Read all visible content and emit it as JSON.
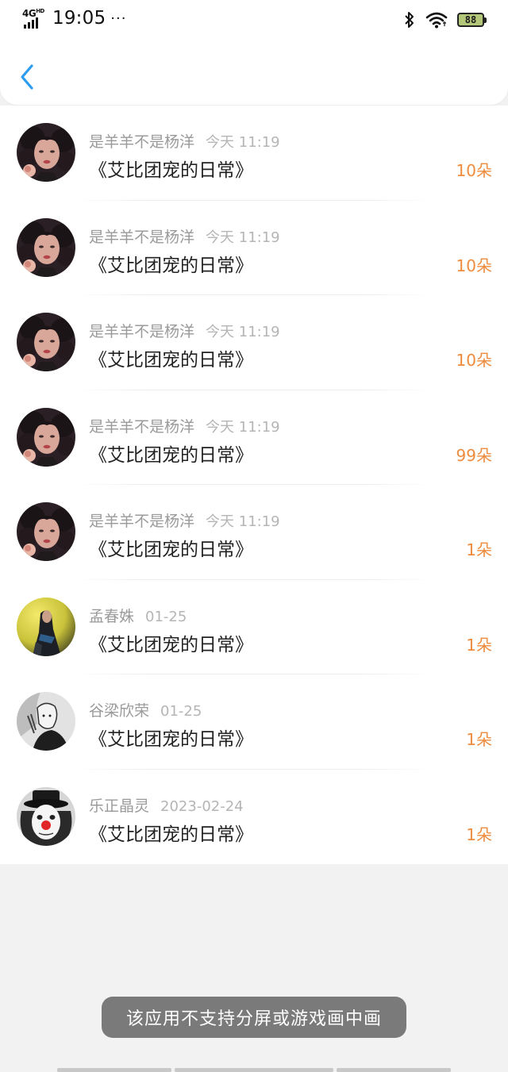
{
  "status_bar": {
    "network": "4G",
    "network_sup": "HD",
    "time": "19:05",
    "more": "···",
    "battery": "88"
  },
  "header": {
    "back_icon": "chevron-left-icon",
    "accent_color": "#2c9cf0"
  },
  "gifts": [
    {
      "sender": "是羊羊不是杨洋",
      "time": "今天 11:19",
      "work": "《艾比团宠的日常》",
      "count": "10朵",
      "avatar": "dark-curly-hair-girl"
    },
    {
      "sender": "是羊羊不是杨洋",
      "time": "今天 11:19",
      "work": "《艾比团宠的日常》",
      "count": "10朵",
      "avatar": "dark-curly-hair-girl"
    },
    {
      "sender": "是羊羊不是杨洋",
      "time": "今天 11:19",
      "work": "《艾比团宠的日常》",
      "count": "10朵",
      "avatar": "dark-curly-hair-girl"
    },
    {
      "sender": "是羊羊不是杨洋",
      "time": "今天 11:19",
      "work": "《艾比团宠的日常》",
      "count": "99朵",
      "avatar": "dark-curly-hair-girl"
    },
    {
      "sender": "是羊羊不是杨洋",
      "time": "今天 11:19",
      "work": "《艾比团宠的日常》",
      "count": "1朵",
      "avatar": "dark-curly-hair-girl"
    },
    {
      "sender": "孟春姝",
      "time": "01-25",
      "work": "《艾比团宠的日常》",
      "count": "1朵",
      "avatar": "person-yellow-background"
    },
    {
      "sender": "谷梁欣荣",
      "time": "01-25",
      "work": "《艾比团宠的日常》",
      "count": "1朵",
      "avatar": "monochrome-sketch"
    },
    {
      "sender": "乐正晶灵",
      "time": "2023-02-24",
      "work": "《艾比团宠的日常》",
      "count": "1朵",
      "avatar": "clown-top-hat"
    }
  ],
  "toast": "该应用不支持分屏或游戏画中画",
  "colors": {
    "count": "#ee8b3c",
    "background": "#f2f2f2",
    "toast_bg": "#7a7a7a"
  }
}
